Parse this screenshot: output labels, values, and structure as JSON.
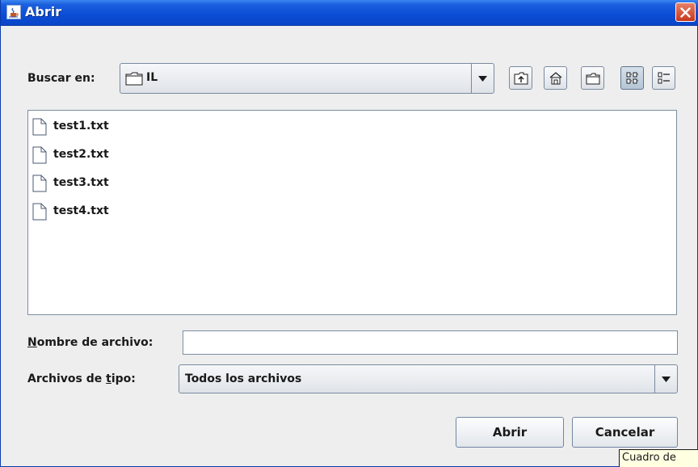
{
  "window": {
    "title": "Abrir"
  },
  "look_in": {
    "label": "Buscar en:",
    "value": "IL"
  },
  "toolbar": [
    {
      "icon": "up-folder-icon"
    },
    {
      "icon": "home-icon"
    },
    {
      "icon": "new-folder-icon"
    },
    {
      "icon": "list-view-icon"
    },
    {
      "icon": "details-view-icon"
    }
  ],
  "files": [
    "test1.txt",
    "test2.txt",
    "test3.txt",
    "test4.txt"
  ],
  "filename": {
    "label_pre": "",
    "label_accel": "N",
    "label_post": "ombre de archivo:",
    "value": ""
  },
  "filetype": {
    "label_pre": "Archivos de ",
    "label_accel": "t",
    "label_post": "ipo:",
    "value": "Todos los archivos"
  },
  "buttons": {
    "open": "Abrir",
    "cancel": "Cancelar"
  },
  "tooltip": "Cuadro de"
}
